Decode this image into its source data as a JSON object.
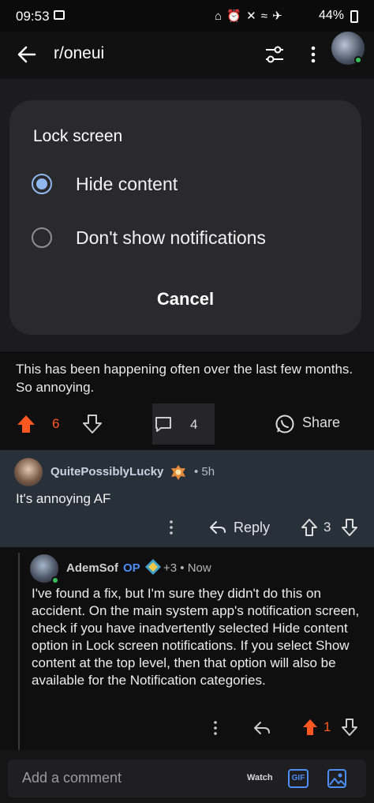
{
  "status_bar": {
    "time": "09:53",
    "icons": "⌂ ⏰ ✕ ≈ ✈",
    "battery": "44%"
  },
  "header": {
    "title": "r/oneui"
  },
  "dialog": {
    "title": "Lock screen",
    "options": [
      {
        "label": "Hide content",
        "selected": true
      },
      {
        "label": "Don't show notifications",
        "selected": false
      }
    ],
    "cancel_label": "Cancel"
  },
  "post": {
    "text": "This has been happening often over the last few months. So annoying.",
    "votes": "6",
    "comments": "4",
    "share_label": "Share"
  },
  "comments": [
    {
      "user": "QuitePossiblyLucky",
      "time": "• 5h",
      "text": "It's annoying AF",
      "reply_label": "Reply",
      "votes": "3"
    },
    {
      "user": "AdemSof",
      "op_label": "OP",
      "meta": "+3 • Now",
      "text": "I've found a fix, but I'm sure they didn't do this on accident. On the main system app's notification screen, check if you have inadvertently selected Hide content option in Lock screen notifications. If you select Show content at the top level, then that option will also be available for the Notification categories.",
      "votes": "1"
    }
  ],
  "composer": {
    "placeholder": "Add a comment",
    "watch_label": "Watch",
    "gif_label": "GIF"
  },
  "colors": {
    "upvote": "#ff5722",
    "accent": "#4c8df6",
    "radio": "#8fb7ee"
  }
}
